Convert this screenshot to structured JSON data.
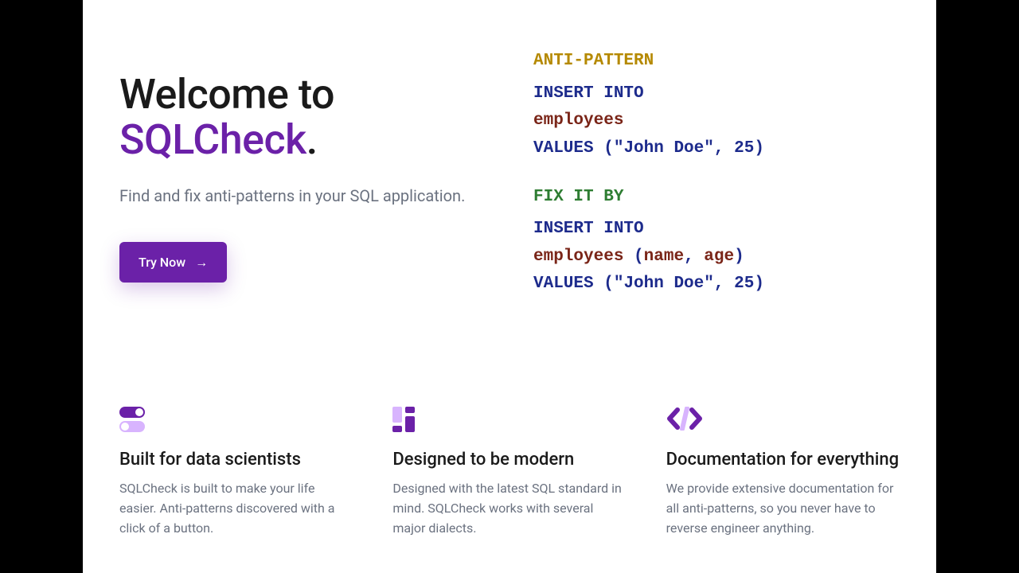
{
  "hero": {
    "title_line1": "Welcome to",
    "brand": "SQLCheck",
    "title_punct": ".",
    "subtitle": "Find and fix anti-patterns in your SQL application.",
    "cta_label": "Try Now"
  },
  "code": {
    "anti_header": "ANTI-PATTERN",
    "fix_header": "FIX IT BY",
    "kw_insert": "INSERT INTO",
    "kw_values": "VALUES",
    "table": "employees",
    "col_name": "name",
    "col_age": "age",
    "str_john": "\"John Doe\"",
    "num_25": "25"
  },
  "features": [
    {
      "title": "Built for data scientists",
      "body": "SQLCheck is built to make your life easier. Anti-patterns discovered with a click of a button."
    },
    {
      "title": "Designed to be modern",
      "body": "Designed with the latest SQL standard in mind. SQLCheck works with several major dialects."
    },
    {
      "title": "Documentation for everything",
      "body": "We provide extensive documentation for all anti-patterns, so you never have to reverse engineer anything."
    }
  ]
}
